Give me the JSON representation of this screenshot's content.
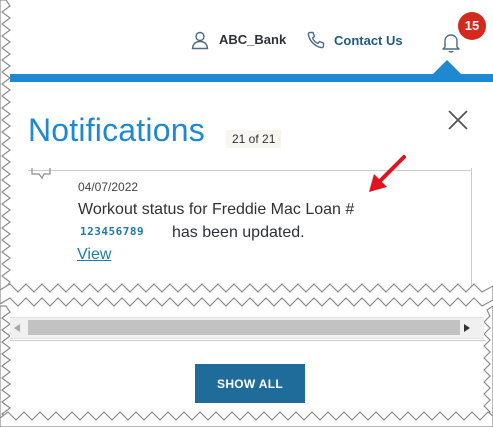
{
  "header": {
    "user_label": "ABC_Bank",
    "contact_label": "Contact Us",
    "notification_count": "15"
  },
  "panel": {
    "title": "Notifications",
    "count_text": "21 of 21"
  },
  "notification": {
    "date": "04/07/2022",
    "message_line1": "Workout status for Freddie Mac Loan #",
    "loan_number": "123456789",
    "message_line2": "has been updated.",
    "link_label": "View"
  },
  "footer": {
    "show_all_label": "SHOW ALL"
  },
  "colors": {
    "accent_blue": "#1e88d2",
    "button_blue": "#1f6c9b",
    "badge_red": "#d42a1e",
    "annotation_red": "#e0141e"
  },
  "icons": [
    "user-icon",
    "phone-icon",
    "bell-icon",
    "close-icon",
    "speech-bubble-icon",
    "scroll-left-icon",
    "scroll-right-icon"
  ]
}
